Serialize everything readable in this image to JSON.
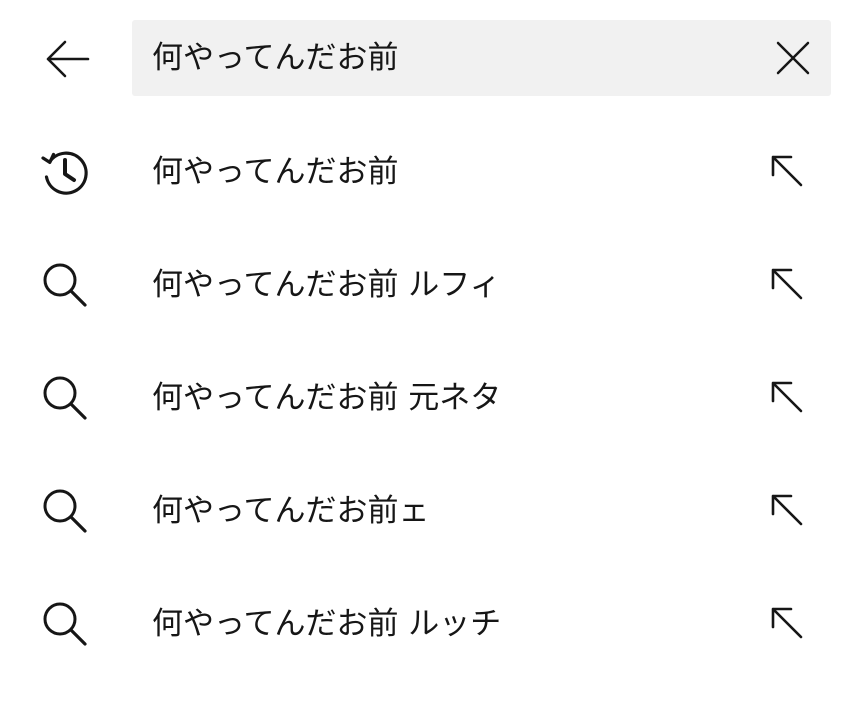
{
  "header": {
    "back_icon": "arrow-left-icon",
    "search_value": "何やってんだお前",
    "clear_icon": "close-icon"
  },
  "suggestions": [
    {
      "type": "history",
      "icon": "history-icon",
      "text": "何やってんだお前",
      "fill_icon": "arrow-up-left-icon"
    },
    {
      "type": "search",
      "icon": "search-icon",
      "text": "何やってんだお前 ルフィ",
      "fill_icon": "arrow-up-left-icon"
    },
    {
      "type": "search",
      "icon": "search-icon",
      "text": "何やってんだお前 元ネタ",
      "fill_icon": "arrow-up-left-icon"
    },
    {
      "type": "search",
      "icon": "search-icon",
      "text": "何やってんだお前ェ",
      "fill_icon": "arrow-up-left-icon"
    },
    {
      "type": "search",
      "icon": "search-icon",
      "text": "何やってんだお前 ルッチ",
      "fill_icon": "arrow-up-left-icon"
    }
  ],
  "colors": {
    "background": "#ffffff",
    "search_box": "#f1f1f1",
    "text": "#161616",
    "icon": "#161616"
  }
}
